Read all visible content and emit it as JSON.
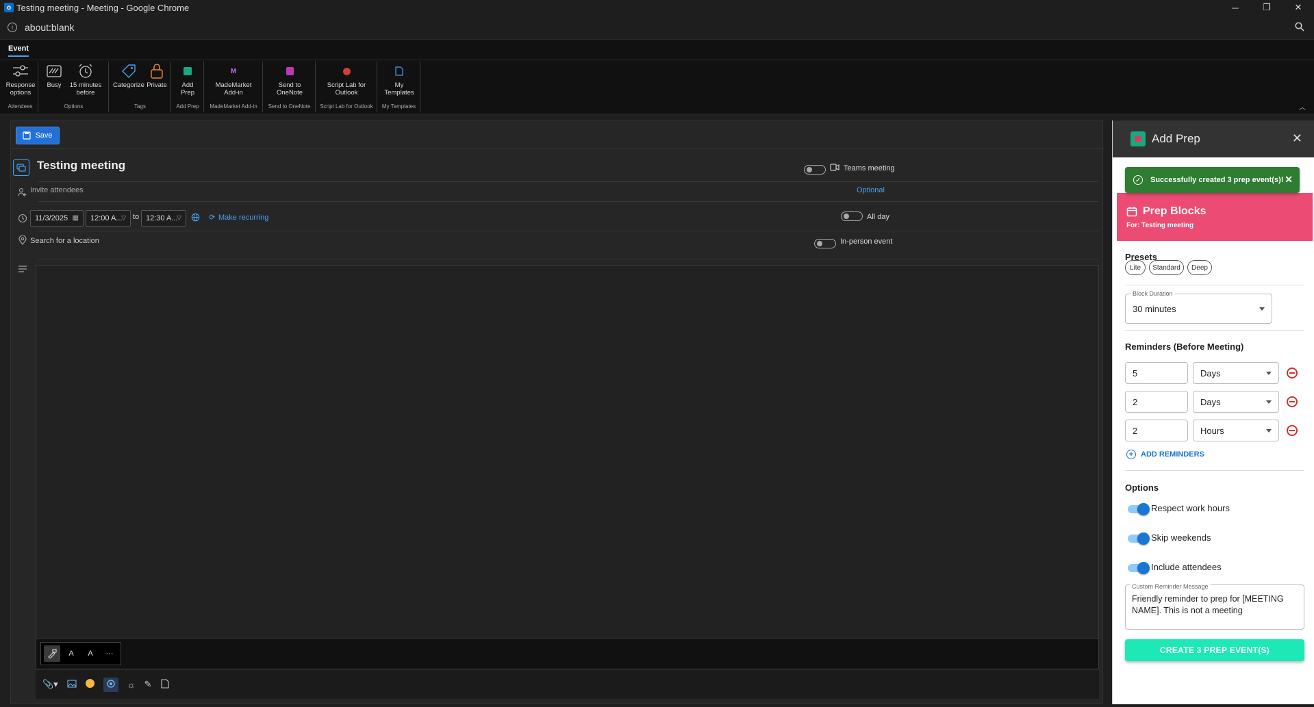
{
  "browser": {
    "window_title": "Testing meeting - Meeting - Google Chrome",
    "address": "about:blank",
    "controls": {
      "minimize": "─",
      "restore": "❐",
      "close": "✕"
    }
  },
  "ribbon": {
    "tab": "Event",
    "groups": [
      {
        "label": "Attendees",
        "buttons": [
          {
            "label": "Response options",
            "icon": "response-options-icon"
          }
        ]
      },
      {
        "label": "Options",
        "buttons": [
          {
            "label": "Busy",
            "icon": "busy-icon"
          },
          {
            "label": "15 minutes before",
            "icon": "alarm-clock-icon"
          }
        ]
      },
      {
        "label": "Tags",
        "buttons": [
          {
            "label": "Categorize",
            "icon": "tag-icon"
          },
          {
            "label": "Private",
            "icon": "lock-icon"
          }
        ]
      },
      {
        "label": "Add Prep",
        "buttons": [
          {
            "label": "Add Prep",
            "icon": "add-prep-icon"
          }
        ]
      },
      {
        "label": "MadeMarket Add-in",
        "buttons": [
          {
            "label": "MadeMarket Add-in",
            "icon": "mademarket-icon"
          }
        ]
      },
      {
        "label": "Send to OneNote",
        "buttons": [
          {
            "label": "Send to OneNote",
            "icon": "onenote-icon"
          }
        ]
      },
      {
        "label": "Script Lab for Outlook",
        "buttons": [
          {
            "label": "Script Lab for Outlook",
            "icon": "script-lab-icon"
          }
        ]
      },
      {
        "label": "My Templates",
        "buttons": [
          {
            "label": "My Templates",
            "icon": "templates-icon"
          }
        ]
      }
    ]
  },
  "form": {
    "save_label": "Save",
    "subject": "Testing meeting",
    "teams_label": "Teams meeting",
    "attendees_placeholder": "Invite attendees",
    "optional_label": "Optional",
    "date": "11/3/2025",
    "start_time": "12:00 A...",
    "to_label": "to",
    "end_time": "12:30 A...",
    "recurring_label": "Make recurring",
    "all_day_label": "All day",
    "location_placeholder": "Search for a location",
    "in_person_label": "In-person event"
  },
  "format_toolbar": {
    "buttons": [
      "format-painter-icon",
      "font-size-icon",
      "superscript-icon",
      "more-icon"
    ],
    "font_size_text": "A",
    "superscript_text": "A",
    "more_text": "···"
  },
  "panel": {
    "title": "Add Prep",
    "toast_text": "Successfully created 3 prep event(s)!",
    "header_title": "Prep Blocks",
    "header_sub": "For: Testing meeting",
    "header_color": "#ec4b73",
    "presets_title": "Presets",
    "presets": [
      "Lite",
      "Standard",
      "Deep"
    ],
    "duration_label": "Block Duration",
    "duration_value": "30 minutes",
    "reminders_title": "Reminders (Before Meeting)",
    "reminders": [
      {
        "amount": "5",
        "unit": "Days"
      },
      {
        "amount": "2",
        "unit": "Days"
      },
      {
        "amount": "2",
        "unit": "Hours"
      }
    ],
    "add_reminders_label": "ADD REMINDERS",
    "options_title": "Options",
    "options": [
      {
        "label": "Respect work hours",
        "on": true
      },
      {
        "label": "Skip weekends",
        "on": true
      },
      {
        "label": "Include attendees",
        "on": true
      }
    ],
    "message_label": "Custom Reminder Message",
    "message_value": "Friendly reminder to prep for [MEETING NAME]. This is not a meeting",
    "create_label": "CREATE 3 PREP EVENT(S)",
    "create_color": "#1de9b6"
  }
}
